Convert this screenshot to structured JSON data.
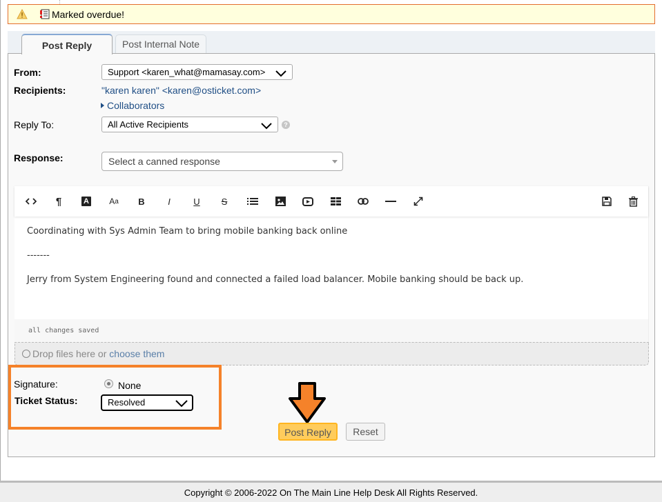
{
  "banner": {
    "message": "Marked overdue!",
    "icons": [
      "warning-icon",
      "overdue-document-icon"
    ]
  },
  "tabs": [
    {
      "label": "Post Reply",
      "active": true
    },
    {
      "label": "Post Internal Note",
      "active": false
    }
  ],
  "form": {
    "from_label": "From:",
    "from_value": "Support <karen_what@mamasay.com>",
    "recipients_label": "Recipients:",
    "recipients_value": "\"karen karen\" <karen@osticket.com>",
    "collaborators_label": "Collaborators",
    "reply_to_label": "Reply To:",
    "reply_to_value": "All Active Recipients",
    "help_glyph": "?",
    "response_label": "Response:",
    "canned_placeholder": "Select a canned response"
  },
  "editor": {
    "toolbar": [
      {
        "name": "html-code-icon",
        "glyph": "<>"
      },
      {
        "name": "paragraph-icon",
        "glyph": "¶"
      },
      {
        "name": "font-color-icon",
        "glyph": "A"
      },
      {
        "name": "font-size-icon",
        "glyph": "Aa"
      },
      {
        "name": "bold-icon",
        "glyph": "B"
      },
      {
        "name": "italic-icon",
        "glyph": "I"
      },
      {
        "name": "underline-icon",
        "glyph": "U"
      },
      {
        "name": "strikethrough-icon",
        "glyph": "S"
      },
      {
        "name": "list-icon",
        "glyph": "≡"
      },
      {
        "name": "image-icon",
        "glyph": ""
      },
      {
        "name": "video-icon",
        "glyph": ""
      },
      {
        "name": "table-icon",
        "glyph": ""
      },
      {
        "name": "link-icon",
        "glyph": ""
      },
      {
        "name": "horizontal-rule-icon",
        "glyph": ""
      },
      {
        "name": "fullscreen-icon",
        "glyph": ""
      },
      {
        "name": "save-draft-icon",
        "glyph": ""
      },
      {
        "name": "delete-draft-icon",
        "glyph": ""
      }
    ],
    "body_lines": [
      "Coordinating with Sys Admin Team to bring mobile banking back online",
      "-------",
      "Jerry from System Engineering found and connected a failed load balancer. Mobile banking should be back up."
    ],
    "status": "all changes saved"
  },
  "attachments": {
    "drop_text": "Drop files here or ",
    "choose_link": "choose them"
  },
  "signature": {
    "label": "Signature:",
    "selected": "None"
  },
  "ticket_status": {
    "label": "Ticket Status:",
    "value": "Resolved"
  },
  "buttons": {
    "post_reply": "Post Reply",
    "reset": "Reset"
  },
  "annotation": {
    "highlight_color": "#f5822a",
    "arrow_color": "#f5822a"
  },
  "footer": {
    "copyright": "Copyright © 2006-2022 On The Main Line Help Desk All Rights Reserved."
  }
}
